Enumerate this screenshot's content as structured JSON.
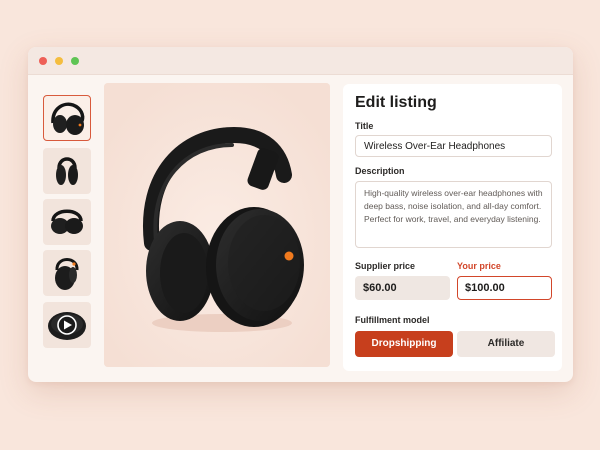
{
  "listing": {
    "title": "Edit listing",
    "title_label": "Title",
    "title_value": "Wireless Over-Ear Headphones",
    "description_label": "Description",
    "description_value": "High-quality wireless over-ear headphones with deep bass, noise isolation, and all-day comfort. Perfect for work, travel, and everyday listening.",
    "supplier_price_label": "Supplier price",
    "supplier_price_value": "$60.00",
    "your_price_label": "Your price",
    "your_price_value": "$100.00",
    "fulfillment_label": "Fulfillment model",
    "fulfillment_options": [
      "Dropshipping",
      "Affiliate"
    ],
    "fulfillment_selected": "Dropshipping"
  },
  "gallery": {
    "thumbnails": [
      "headphones-front",
      "headphones-side",
      "headphones-folded",
      "headphones-back",
      "headphones-video"
    ],
    "selected_index": 0
  },
  "colors": {
    "accent": "#c73f1d",
    "accent_text": "#d2462a",
    "background": "#f9e6dc",
    "product_dot": "#f07a1e"
  }
}
